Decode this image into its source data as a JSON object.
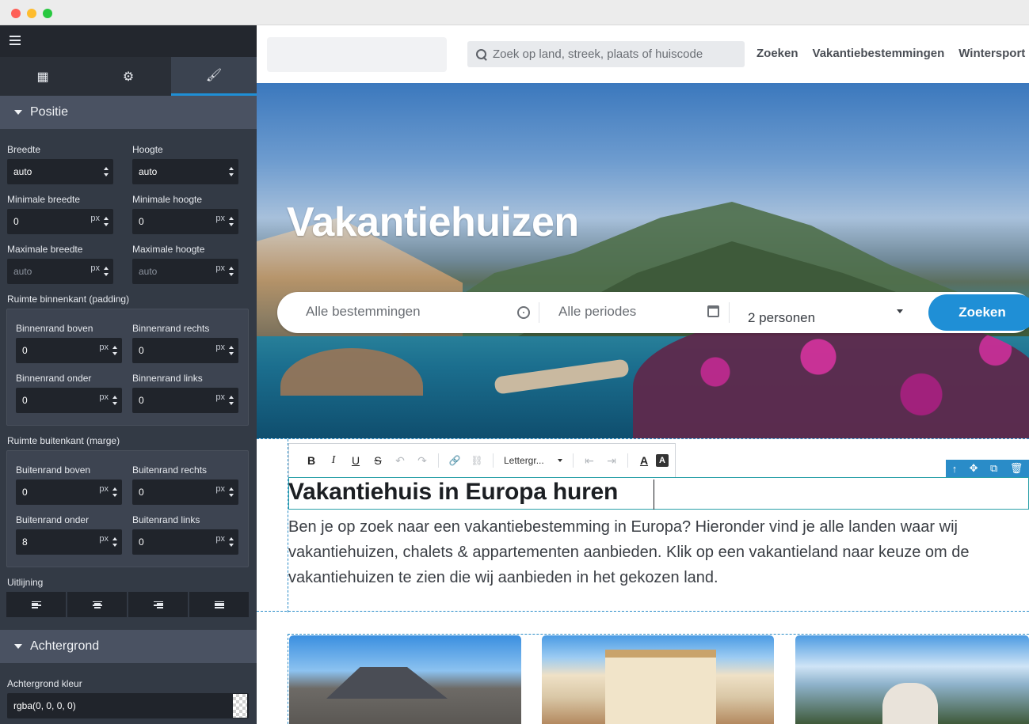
{
  "sidebar": {
    "tabs": [
      {
        "name": "widgets-icon",
        "glyph": "▦"
      },
      {
        "name": "gear-icon",
        "glyph": "⚙"
      },
      {
        "name": "brush-icon",
        "glyph": "🖌"
      }
    ],
    "positie": {
      "title": "Positie",
      "breedte_label": "Breedte",
      "breedte_value": "auto",
      "hoogte_label": "Hoogte",
      "hoogte_value": "auto",
      "min_breedte_label": "Minimale breedte",
      "min_breedte_value": "0",
      "min_hoogte_label": "Minimale hoogte",
      "min_hoogte_value": "0",
      "max_breedte_label": "Maximale breedte",
      "max_breedte_placeholder": "auto",
      "max_hoogte_label": "Maximale hoogte",
      "max_hoogte_placeholder": "auto",
      "unit": "px"
    },
    "padding": {
      "title": "Ruimte binnenkant (padding)",
      "boven_label": "Binnenrand boven",
      "boven_value": "0",
      "rechts_label": "Binnenrand rechts",
      "rechts_value": "0",
      "onder_label": "Binnenrand onder",
      "onder_value": "0",
      "links_label": "Binnenrand links",
      "links_value": "0"
    },
    "margin": {
      "title": "Ruimte buitenkant (marge)",
      "boven_label": "Buitenrand boven",
      "boven_value": "0",
      "rechts_label": "Buitenrand rechts",
      "rechts_value": "0",
      "onder_label": "Buitenrand onder",
      "onder_value": "8",
      "links_label": "Buitenrand links",
      "links_value": "0"
    },
    "uitlijning_label": "Uitlijning",
    "achtergrond": {
      "title": "Achtergrond",
      "kleur_label": "Achtergrond kleur",
      "kleur_value": "rgba(0, 0, 0, 0)"
    }
  },
  "header": {
    "search_placeholder": "Zoek op land, streek, plaats of huiscode",
    "nav": [
      "Zoeken",
      "Vakantiebestemmingen",
      "Wintersport"
    ]
  },
  "hero": {
    "title": "Vakantiehuizen",
    "destination_placeholder": "Alle bestemmingen",
    "period_placeholder": "Alle periodes",
    "persons_value": "2 personen",
    "search_button": "Zoeken"
  },
  "editor": {
    "toolbar": {
      "bold": "B",
      "italic": "I",
      "underline": "U",
      "strike": "S",
      "undo": "↶",
      "redo": "↷",
      "link": "🔗",
      "unlink": "⛓",
      "font_label": "Lettergr...",
      "outdent": "⇤",
      "indent": "⇥",
      "text_color": "A",
      "bg_color": "A"
    },
    "element_tools": [
      "↑",
      "✥",
      "⧉",
      "🗑"
    ],
    "heading": "Vakantiehuis in Europa huren",
    "paragraph": "Ben je op zoek naar een vakantiebestemming in Europa? Hieronder vind je alle landen waar wij vakantiehuizen, chalets & appartementen aanbieden. Klik op een vakantieland naar keuze om de vakantiehuizen te zien die wij aanbieden in het gekozen land."
  },
  "colors": {
    "accent": "#1f8fd6",
    "sidebar_bg": "#333a45",
    "section_head": "#4a5262"
  }
}
